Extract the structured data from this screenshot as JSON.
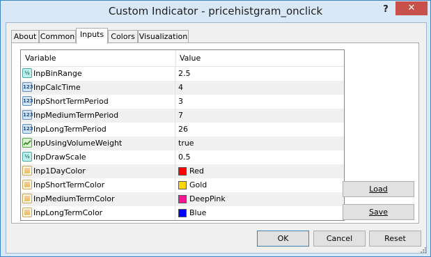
{
  "window": {
    "title": "Custom Indicator - pricehistgram_onclick",
    "help_glyph": "?",
    "close_glyph": "✕"
  },
  "tabs": [
    {
      "label": "About",
      "active": false
    },
    {
      "label": "Common",
      "active": false
    },
    {
      "label": "Inputs",
      "active": true
    },
    {
      "label": "Colors",
      "active": false
    },
    {
      "label": "Visualization",
      "active": false
    }
  ],
  "grid": {
    "col_variable": "Variable",
    "col_value": "Value",
    "rows": [
      {
        "icon": "frac",
        "icon_text": "½",
        "name": "InpBinRange",
        "value": "2.5"
      },
      {
        "icon": "num",
        "icon_text": "123",
        "name": "InpCalcTime",
        "value": "4"
      },
      {
        "icon": "num",
        "icon_text": "123",
        "name": "InpShortTermPeriod",
        "value": "3"
      },
      {
        "icon": "num",
        "icon_text": "123",
        "name": "InpMediumTermPeriod",
        "value": "7"
      },
      {
        "icon": "num",
        "icon_text": "123",
        "name": "InpLongTermPeriod",
        "value": "26"
      },
      {
        "icon": "bool",
        "icon_text": "",
        "name": "InpUsingVolumeWeight",
        "value": "true"
      },
      {
        "icon": "frac",
        "icon_text": "½",
        "name": "InpDrawScale",
        "value": "0.5"
      },
      {
        "icon": "color",
        "icon_text": "",
        "name": "Inp1DayColor",
        "value": "Red",
        "swatch": "#ff0000"
      },
      {
        "icon": "color",
        "icon_text": "",
        "name": "InpShortTermColor",
        "value": "Gold",
        "swatch": "#ffd700"
      },
      {
        "icon": "color",
        "icon_text": "",
        "name": "InpMediumTermColor",
        "value": "DeepPink",
        "swatch": "#ff1493"
      },
      {
        "icon": "color",
        "icon_text": "",
        "name": "InpLongTermColor",
        "value": "Blue",
        "swatch": "#0000ff"
      }
    ]
  },
  "side_buttons": {
    "load_label": "Load",
    "save_label": "Save"
  },
  "footer": {
    "ok_label": "OK",
    "cancel_label": "Cancel",
    "reset_label": "Reset"
  }
}
